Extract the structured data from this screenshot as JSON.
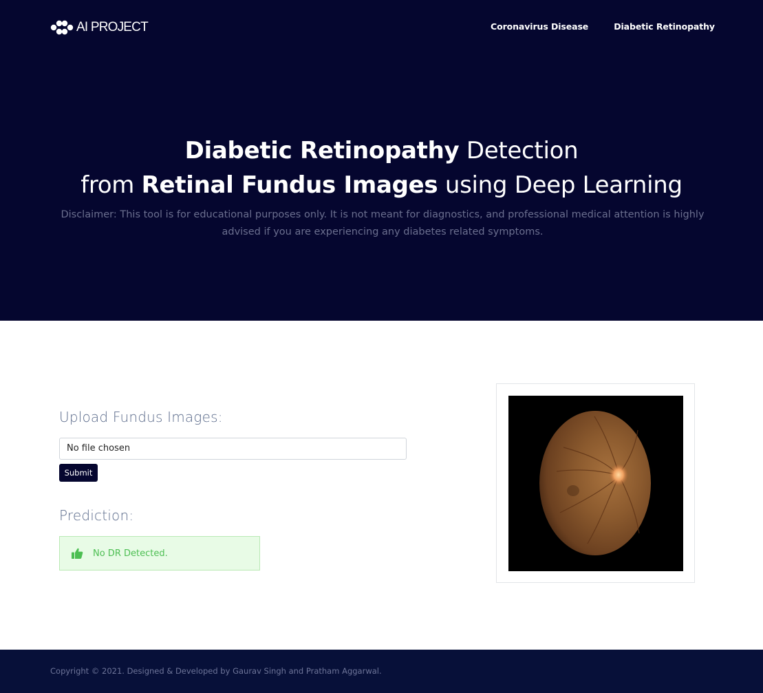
{
  "header": {
    "logo_text": "AI PROJECT",
    "logo_icon": "molecule-logo-icon",
    "nav": [
      "Coronavirus Disease",
      "Diabetic Retinopathy"
    ]
  },
  "hero": {
    "line1_bold": "Diabetic Retinopathy",
    "line1_rest": " Detection",
    "line2_pre": "from ",
    "line2_bold": "Retinal Fundus Images",
    "line2_post": " using Deep Learning",
    "disclaimer": "Disclaimer: This tool is for educational purposes only. It is not meant for diagnostics, and professional medical attention is highly advised if you are experiencing any diabetes related symptoms."
  },
  "upload": {
    "title": "Upload Fundus Images:",
    "file_status": "No file chosen",
    "submit_label": "Submit"
  },
  "prediction": {
    "title": "Prediction:",
    "result": "No DR Detected.",
    "icon": "thumbs-up-icon"
  },
  "image": {
    "icon": "retinal-fundus-image"
  },
  "footer": {
    "copyright": "Copyright © 2021. Designed & Developed by Gaurav Singh and Pratham Aggarwal."
  },
  "colors": {
    "hero_bg": "#05062f",
    "footer_bg": "#071039",
    "accent_green": "#4cbe52",
    "result_bg": "#e8fbe6"
  }
}
